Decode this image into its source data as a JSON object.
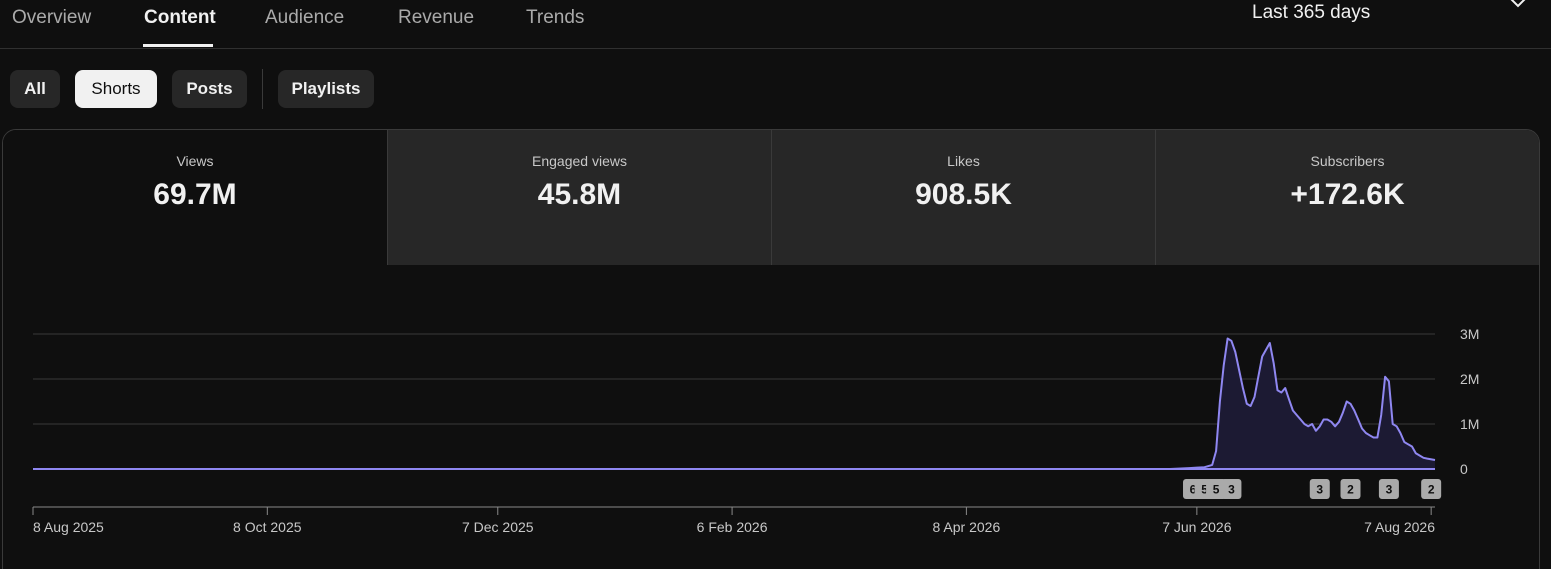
{
  "tabs": [
    {
      "label": "Overview",
      "active": false
    },
    {
      "label": "Content",
      "active": true
    },
    {
      "label": "Audience",
      "active": false
    },
    {
      "label": "Revenue",
      "active": false
    },
    {
      "label": "Trends",
      "active": false
    }
  ],
  "period": {
    "label": "Last 365 days",
    "icon": "chevron-down-icon"
  },
  "filters": [
    {
      "label": "All",
      "selected": false
    },
    {
      "label": "Shorts",
      "selected": true
    },
    {
      "label": "Posts",
      "selected": false
    },
    {
      "label": "Playlists",
      "selected": false
    }
  ],
  "metrics": [
    {
      "label": "Views",
      "value": "69.7M",
      "active": true
    },
    {
      "label": "Engaged views",
      "value": "45.8M",
      "active": false
    },
    {
      "label": "Likes",
      "value": "908.5K",
      "active": false
    },
    {
      "label": "Subscribers",
      "value": "+172.6K",
      "active": false
    }
  ],
  "colors": {
    "line": "#8f87f1",
    "fill": "#1c1a33",
    "grid": "#3a3a3a",
    "badge": "#aaaaaa"
  },
  "chart_data": {
    "type": "area",
    "metric": "Views",
    "ylim": [
      0,
      3000000
    ],
    "yticks": [
      {
        "value": 0,
        "label": "0"
      },
      {
        "value": 1000000,
        "label": "1M"
      },
      {
        "value": 2000000,
        "label": "2M"
      },
      {
        "value": 3000000,
        "label": "3M"
      }
    ],
    "xrange": [
      "2025-08-08",
      "2026-08-08"
    ],
    "xticks": [
      {
        "date": "2025-08-08",
        "label": "8 Aug 2025"
      },
      {
        "date": "2025-10-08",
        "label": "8 Oct 2025"
      },
      {
        "date": "2025-12-07",
        "label": "7 Dec 2025"
      },
      {
        "date": "2026-02-06",
        "label": "6 Feb 2026"
      },
      {
        "date": "2026-04-08",
        "label": "8 Apr 2026"
      },
      {
        "date": "2026-06-07",
        "label": "7 Jun 2026"
      },
      {
        "date": "2026-08-07",
        "label": "7 Aug 2026"
      }
    ],
    "grid": true,
    "series": [
      {
        "points": [
          [
            "2025-08-08",
            0
          ],
          [
            "2026-05-31",
            0
          ],
          [
            "2026-06-05",
            20000
          ],
          [
            "2026-06-07",
            30000
          ],
          [
            "2026-06-09",
            40000
          ],
          [
            "2026-06-11",
            90000
          ],
          [
            "2026-06-12",
            400000
          ],
          [
            "2026-06-13",
            1500000
          ],
          [
            "2026-06-14",
            2300000
          ],
          [
            "2026-06-15",
            2900000
          ],
          [
            "2026-06-16",
            2850000
          ],
          [
            "2026-06-17",
            2600000
          ],
          [
            "2026-06-18",
            2200000
          ],
          [
            "2026-06-19",
            1800000
          ],
          [
            "2026-06-20",
            1450000
          ],
          [
            "2026-06-21",
            1400000
          ],
          [
            "2026-06-22",
            1600000
          ],
          [
            "2026-06-23",
            2050000
          ],
          [
            "2026-06-24",
            2500000
          ],
          [
            "2026-06-25",
            2650000
          ],
          [
            "2026-06-26",
            2800000
          ],
          [
            "2026-06-27",
            2350000
          ],
          [
            "2026-06-28",
            1750000
          ],
          [
            "2026-06-29",
            1700000
          ],
          [
            "2026-06-30",
            1800000
          ],
          [
            "2026-07-01",
            1550000
          ],
          [
            "2026-07-02",
            1300000
          ],
          [
            "2026-07-03",
            1200000
          ],
          [
            "2026-07-04",
            1100000
          ],
          [
            "2026-07-05",
            1000000
          ],
          [
            "2026-07-06",
            950000
          ],
          [
            "2026-07-07",
            1000000
          ],
          [
            "2026-07-08",
            850000
          ],
          [
            "2026-07-09",
            950000
          ],
          [
            "2026-07-10",
            1100000
          ],
          [
            "2026-07-11",
            1100000
          ],
          [
            "2026-07-12",
            1050000
          ],
          [
            "2026-07-13",
            950000
          ],
          [
            "2026-07-14",
            1050000
          ],
          [
            "2026-07-15",
            1250000
          ],
          [
            "2026-07-16",
            1500000
          ],
          [
            "2026-07-17",
            1450000
          ],
          [
            "2026-07-18",
            1300000
          ],
          [
            "2026-07-19",
            1100000
          ],
          [
            "2026-07-20",
            900000
          ],
          [
            "2026-07-21",
            800000
          ],
          [
            "2026-07-22",
            750000
          ],
          [
            "2026-07-23",
            700000
          ],
          [
            "2026-07-24",
            700000
          ],
          [
            "2026-07-25",
            1200000
          ],
          [
            "2026-07-26",
            2050000
          ],
          [
            "2026-07-27",
            1950000
          ],
          [
            "2026-07-28",
            1000000
          ],
          [
            "2026-07-29",
            950000
          ],
          [
            "2026-07-30",
            800000
          ],
          [
            "2026-07-31",
            600000
          ],
          [
            "2026-08-01",
            550000
          ],
          [
            "2026-08-02",
            500000
          ],
          [
            "2026-08-03",
            350000
          ],
          [
            "2026-08-04",
            300000
          ],
          [
            "2026-08-05",
            250000
          ],
          [
            "2026-08-06",
            230000
          ],
          [
            "2026-08-08",
            200000
          ]
        ]
      }
    ],
    "markers": [
      {
        "date": "2026-06-06",
        "label": "6"
      },
      {
        "date": "2026-06-09",
        "label": "5"
      },
      {
        "date": "2026-06-12",
        "label": "5"
      },
      {
        "date": "2026-06-16",
        "label": "3"
      },
      {
        "date": "2026-07-09",
        "label": "3"
      },
      {
        "date": "2026-07-17",
        "label": "2"
      },
      {
        "date": "2026-07-27",
        "label": "3"
      },
      {
        "date": "2026-08-07",
        "label": "2"
      }
    ]
  }
}
